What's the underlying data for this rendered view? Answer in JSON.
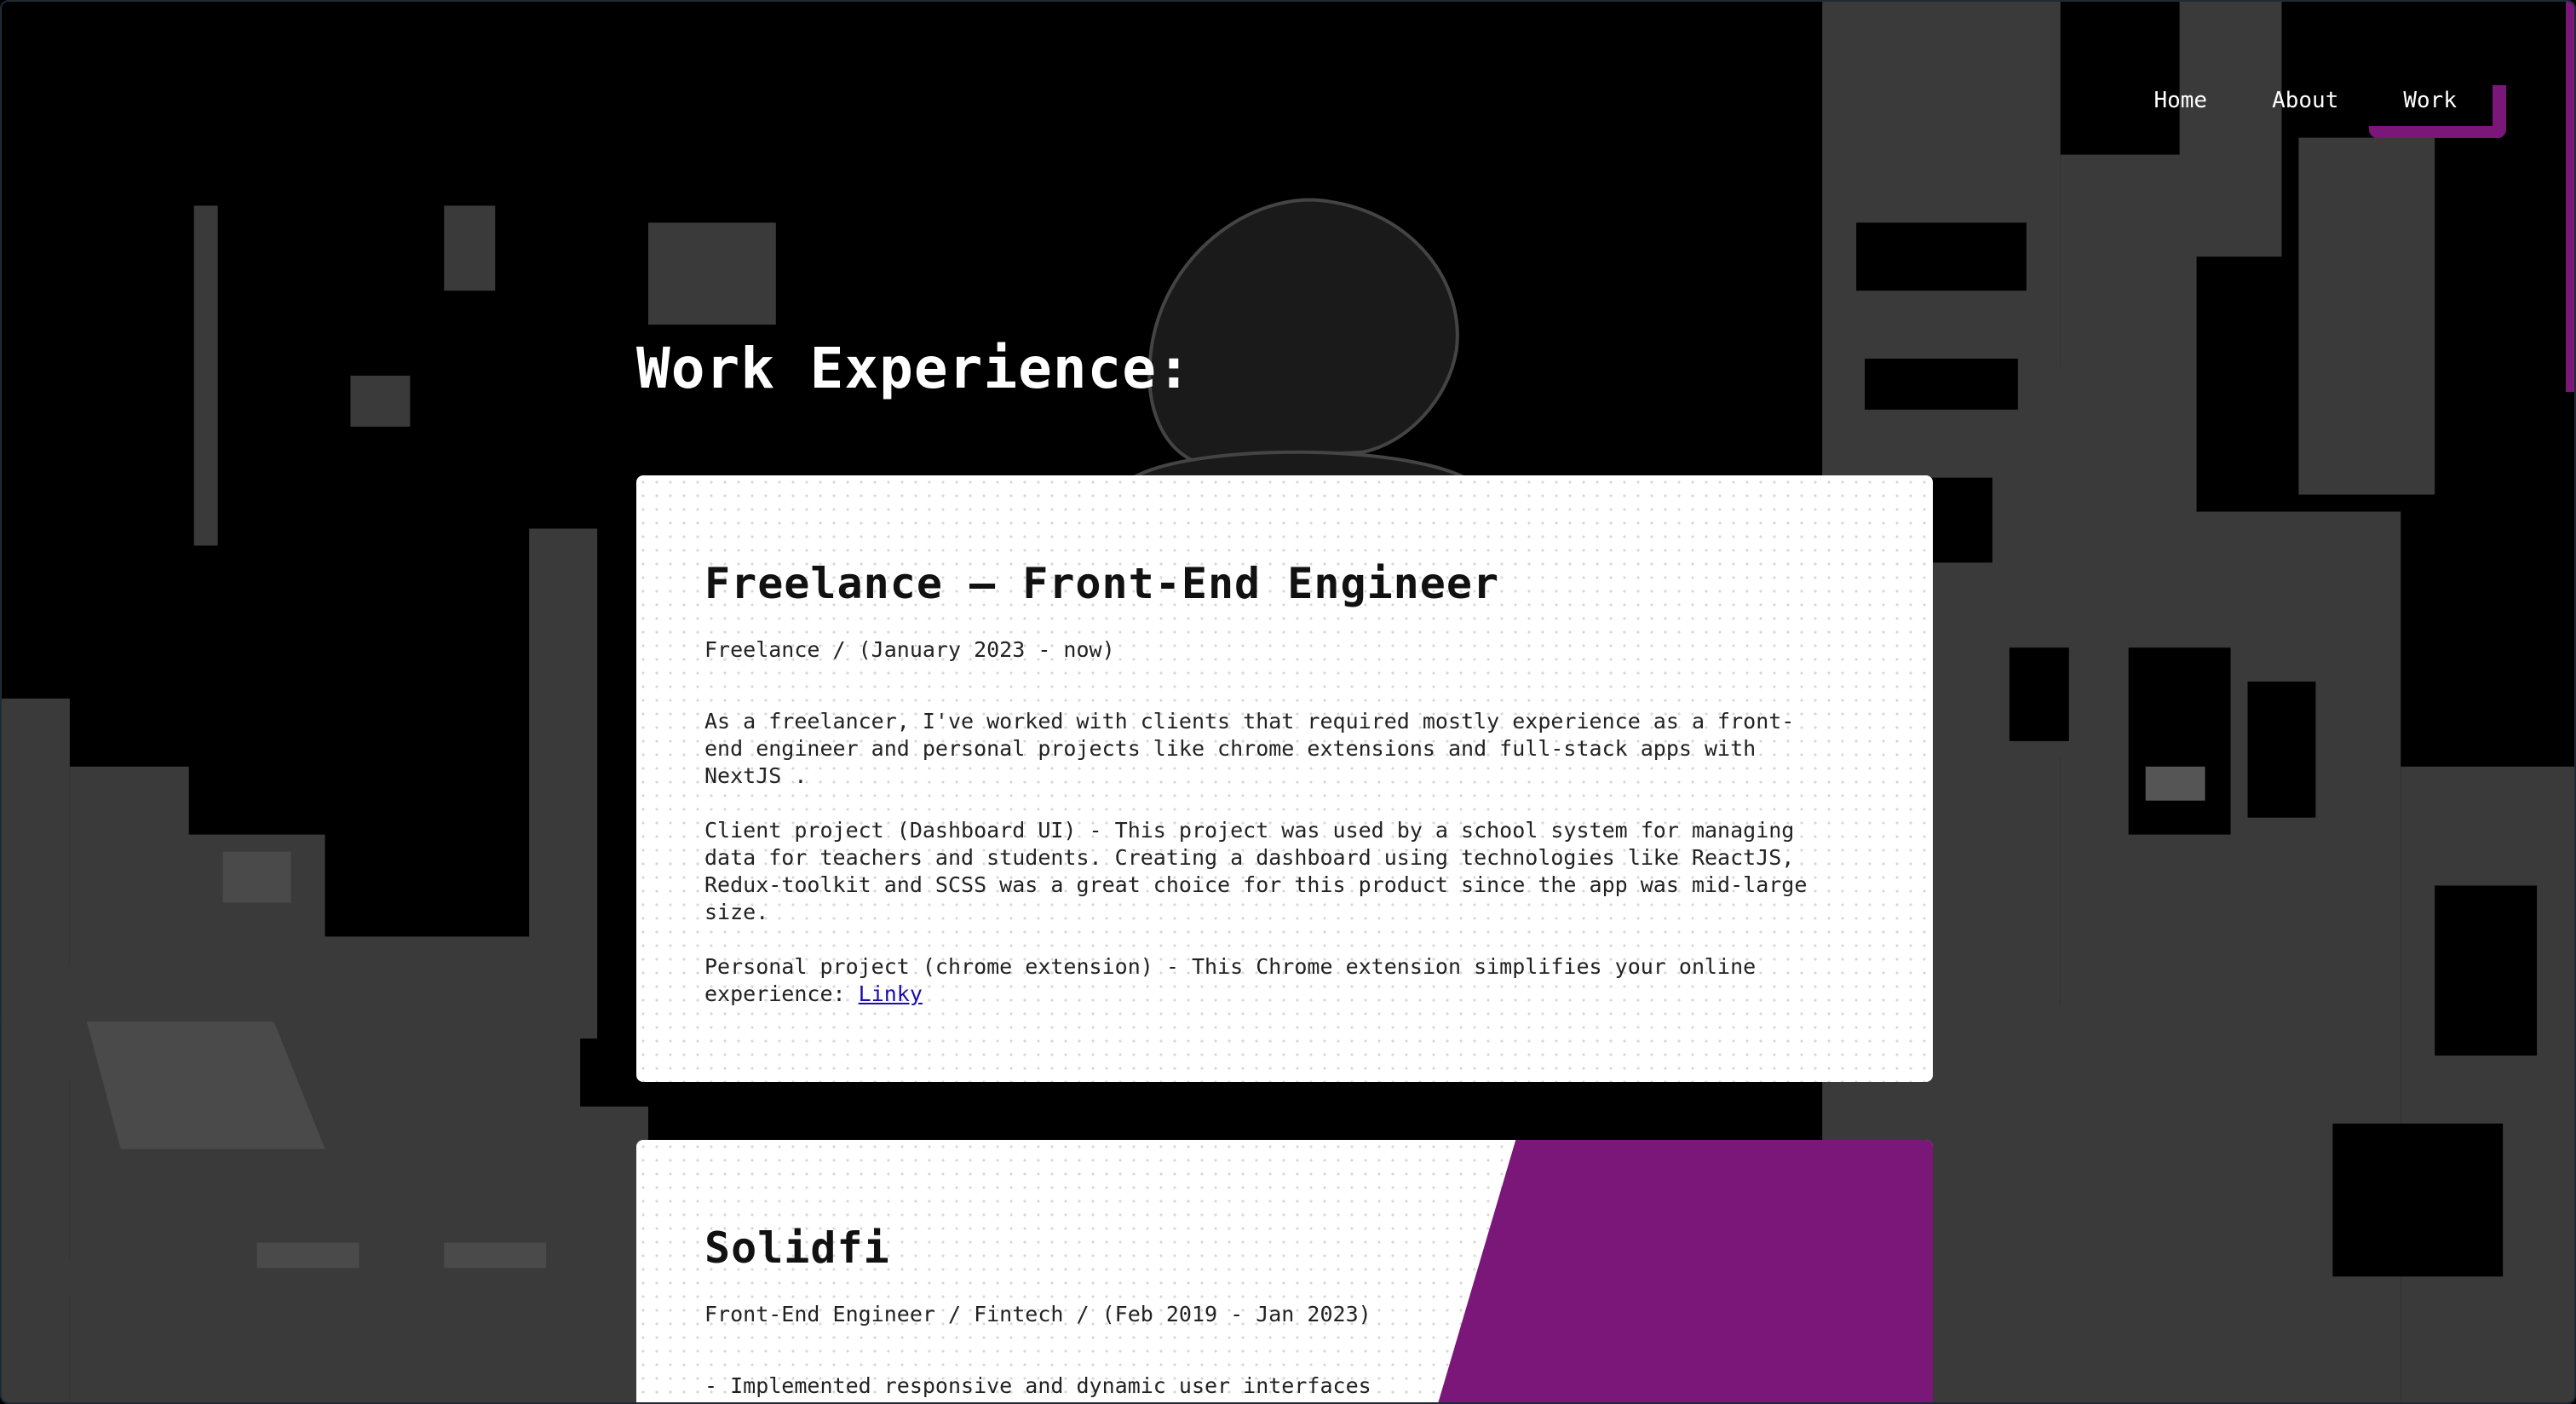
{
  "nav": {
    "items": [
      {
        "label": "Home"
      },
      {
        "label": "About"
      },
      {
        "label": "Work"
      }
    ],
    "active": "Work"
  },
  "page": {
    "title": "Work Experience:"
  },
  "experiences": [
    {
      "title": "Freelance – Front-End Engineer",
      "meta": "Freelance / (January 2023 - now)",
      "paragraphs": [
        "As a freelancer, I've worked with clients that required mostly experience as a front-end engineer and personal projects like chrome extensions and full-stack apps with NextJS .",
        "Client project (Dashboard UI) - This project was used by a school system for managing data for teachers and students. Creating a dashboard using technologies like ReactJS, Redux-toolkit and SCSS was a great choice for this product since the app was mid-large size.",
        "Personal project (chrome extension) - This Chrome extension simplifies your online experience:"
      ],
      "link_label": "Linky"
    },
    {
      "title": "Solidfi",
      "meta": "Front-End Engineer / Fintech / (Feb 2019 - Jan 2023)",
      "paragraphs": [
        "- Implemented responsive and dynamic user interfaces"
      ]
    }
  ],
  "colors": {
    "accent": "#7a1779",
    "background": "#000000",
    "card": "#ffffff"
  }
}
